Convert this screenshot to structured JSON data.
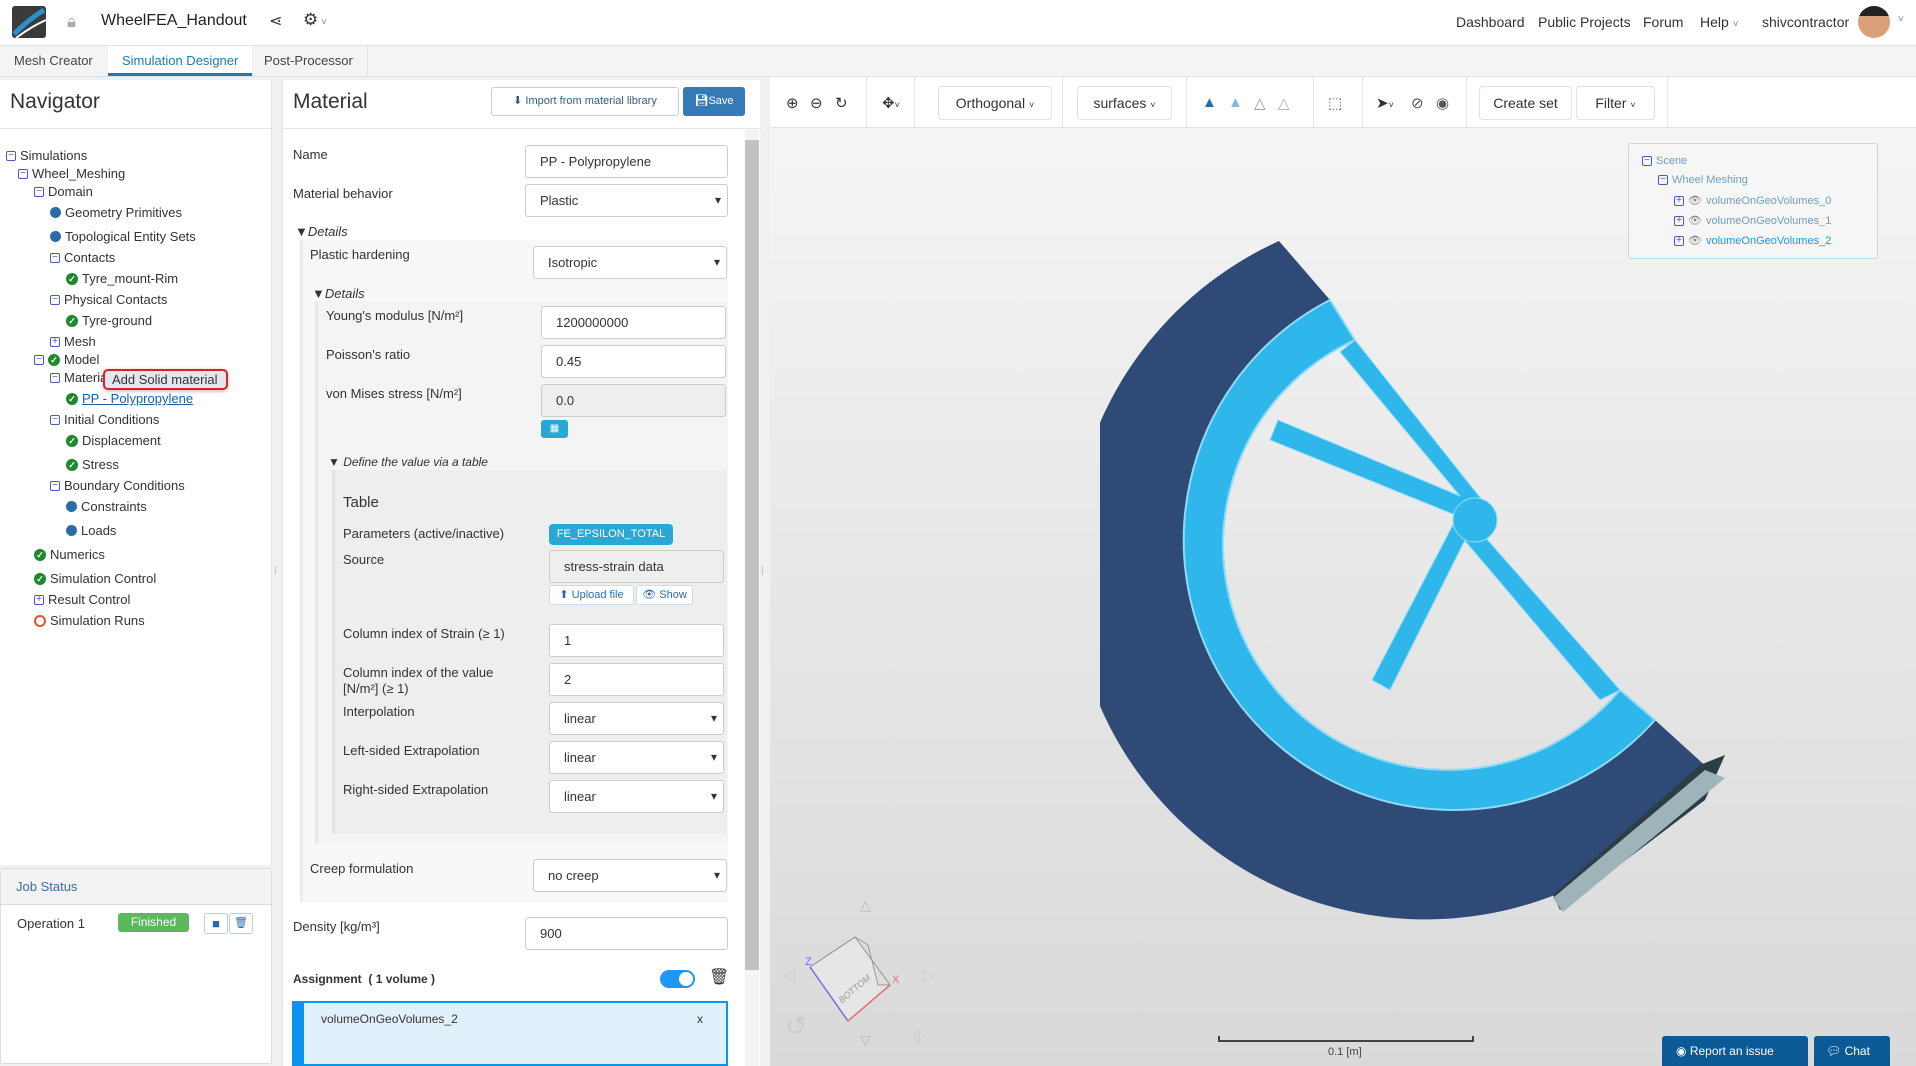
{
  "header": {
    "project_title": "WheelFEA_Handout",
    "nav": [
      "Dashboard",
      "Public Projects",
      "Forum",
      "Help"
    ],
    "username": "shivcontractor"
  },
  "tabs": [
    {
      "label": "Mesh Creator"
    },
    {
      "label": "Simulation Designer"
    },
    {
      "label": "Post-Processor"
    }
  ],
  "navigator": {
    "title": "Navigator",
    "tree": [
      {
        "label": "Simulations",
        "icon": "minus"
      },
      {
        "label": "Wheel_Meshing",
        "icon": "minus"
      },
      {
        "label": "Domain",
        "icon": "minus"
      },
      {
        "label": "Geometry Primitives",
        "icon": "dot"
      },
      {
        "label": "Topological Entity Sets",
        "icon": "dot"
      },
      {
        "label": "Contacts",
        "icon": "minus"
      },
      {
        "label": "Tyre_mount-Rim",
        "icon": "check"
      },
      {
        "label": "Physical Contacts",
        "icon": "minus"
      },
      {
        "label": "Tyre-ground",
        "icon": "check"
      },
      {
        "label": "Mesh",
        "icon": "plus"
      },
      {
        "label": "Model",
        "icon": "minus-check"
      },
      {
        "label": "Materials",
        "icon": "minus"
      },
      {
        "label": "PP - Polypropylene",
        "icon": "check"
      },
      {
        "label": "Initial Conditions",
        "icon": "minus"
      },
      {
        "label": "Displacement",
        "icon": "check"
      },
      {
        "label": "Stress",
        "icon": "check"
      },
      {
        "label": "Boundary Conditions",
        "icon": "minus"
      },
      {
        "label": "Constraints",
        "icon": "dot"
      },
      {
        "label": "Loads",
        "icon": "dot"
      },
      {
        "label": "Numerics",
        "icon": "check"
      },
      {
        "label": "Simulation Control",
        "icon": "check"
      },
      {
        "label": "Result Control",
        "icon": "plus"
      },
      {
        "label": "Simulation Runs",
        "icon": "ring"
      }
    ],
    "context_menu": "Add Solid material"
  },
  "job_status": {
    "title": "Job Status",
    "operation": "Operation 1",
    "status": "Finished"
  },
  "material": {
    "title": "Material",
    "import_label": "Import from material library",
    "save_label": "Save",
    "name_label": "Name",
    "name_value": "PP  - Polypropylene",
    "behavior_label": "Material behavior",
    "behavior_value": "Plastic",
    "details_label": "Details",
    "hardening_label": "Plastic hardening",
    "hardening_value": "Isotropic",
    "details2_label": "Details",
    "youngs_label": "Young's modulus [N/m²]",
    "youngs_value": "1200000000",
    "poisson_label": "Poisson's ratio",
    "poisson_value": "0.45",
    "mises_label": "von Mises stress [N/m²]",
    "mises_value": "0.0",
    "define_table_label": "Define the value via a table",
    "table_title": "Table",
    "params_label": "Parameters (active/inactive)",
    "params_badge": "FE_EPSILON_TOTAL",
    "source_label": "Source",
    "source_value": "stress-strain data",
    "upload_label": "Upload file",
    "show_label": "Show",
    "col_strain_label": "Column index of Strain (≥ 1)",
    "col_strain_value": "1",
    "col_value_label1": "Column index of the value",
    "col_value_label2": "[N/m²] (≥ 1)",
    "col_value_value": "2",
    "interp_label": "Interpolation",
    "interp_value": "linear",
    "left_label": "Left-sided Extrapolation",
    "left_value": "linear",
    "right_label": "Right-sided Extrapolation",
    "right_value": "linear",
    "creep_label": "Creep formulation",
    "creep_value": "no creep",
    "density_label": "Density [kg/m³]",
    "density_value": "900",
    "assignment_label": "Assignment",
    "assignment_count": "( 1 volume )",
    "assignment_enabled": true,
    "assigned_item": "volumeOnGeoVolumes_2",
    "remove_label": "x"
  },
  "viewer": {
    "projection": "Orthogonal",
    "render_mode": "surfaces",
    "create_set": "Create set",
    "filter": "Filter",
    "scene": {
      "root": "Scene",
      "group": "Wheel Meshing",
      "items": [
        "volumeOnGeoVolumes_0",
        "volumeOnGeoVolumes_1",
        "volumeOnGeoVolumes_2"
      ]
    },
    "cube_face": "BOTTOM",
    "scale_label": "0.1 [m]",
    "axis_x": "X",
    "axis_z": "Z"
  },
  "footer": {
    "report": "Report an issue",
    "chat": "Chat"
  },
  "colors": {
    "accent": "#1a7ab8",
    "save": "#337ab7",
    "badge": "#29a8d6",
    "finished": "#5cb85c",
    "wheel_blue": "#2fb6ea",
    "wheel_dark": "#2f4a77"
  }
}
